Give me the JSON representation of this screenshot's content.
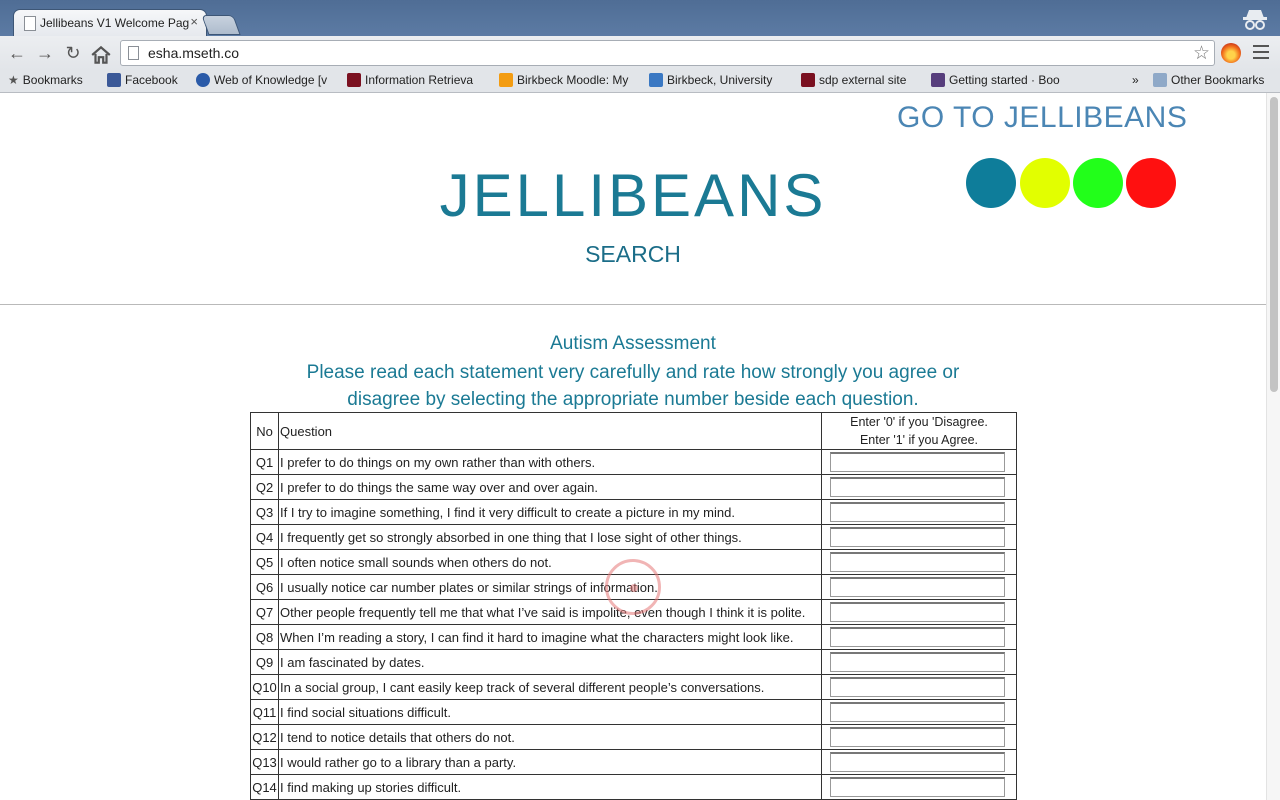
{
  "browser": {
    "tab_title": "Jellibeans V1 Welcome Pag",
    "tab_close": "×",
    "url": "esha.mseth.co",
    "bookmarks": [
      {
        "label": "Bookmarks",
        "icon": "star-icon"
      },
      {
        "label": "Facebook",
        "icon": "facebook-icon"
      },
      {
        "label": "Web of Knowledge [v",
        "icon": "web-of-knowledge-icon"
      },
      {
        "label": "Information Retrieva",
        "icon": "birkbeck-icon"
      },
      {
        "label": "Birkbeck Moodle: My",
        "icon": "moodle-icon"
      },
      {
        "label": "Birkbeck, University",
        "icon": "calendar-icon"
      },
      {
        "label": "sdp external site",
        "icon": "birkbeck-icon"
      },
      {
        "label": "Getting started · Boo",
        "icon": "bootstrap-icon"
      }
    ],
    "overflow": "»",
    "other_bookmarks": "Other Bookmarks"
  },
  "header": {
    "goto_label": "GO TO JELLIBEANS",
    "brand": "JELLIBEANS",
    "search_label": "SEARCH",
    "dots": [
      "#0e7d9a",
      "#e2ff00",
      "#22ff1a",
      "#ff1010"
    ]
  },
  "assessment": {
    "title": "Autism Assessment",
    "instructions": "Please read each statement very carefully and rate how strongly you agree or disagree by selecting the appropriate number beside each question.",
    "columns": {
      "no": "No",
      "question": "Question",
      "answer_line1": "Enter '0' if you 'Disagree.",
      "answer_line2": "Enter '1' if you Agree."
    },
    "rows": [
      {
        "no": "Q1",
        "text": "I prefer to do things on my own rather than with others.",
        "value": ""
      },
      {
        "no": "Q2",
        "text": "I prefer to do things the same way over and over again.",
        "value": ""
      },
      {
        "no": "Q3",
        "text": "If I try to imagine something, I find it very difficult to create a picture in my mind.",
        "value": ""
      },
      {
        "no": "Q4",
        "text": "I frequently get so strongly absorbed in one thing that I lose sight of other things.",
        "value": ""
      },
      {
        "no": "Q5",
        "text": "I often notice small sounds when others do not.",
        "value": ""
      },
      {
        "no": "Q6",
        "text": "I usually notice car number plates or similar strings of information.",
        "value": ""
      },
      {
        "no": "Q7",
        "text": "Other people frequently tell me that what I’ve said is impolite, even though I think it is polite.",
        "value": ""
      },
      {
        "no": "Q8",
        "text": "When I’m reading a story, I can find it hard to imagine what the characters might look like.",
        "value": ""
      },
      {
        "no": "Q9",
        "text": "I am fascinated by dates.",
        "value": ""
      },
      {
        "no": "Q10",
        "text": "In a social group, I cant easily keep track of several different people’s conversations.",
        "value": ""
      },
      {
        "no": "Q11",
        "text": "I find social situations difficult.",
        "value": ""
      },
      {
        "no": "Q12",
        "text": "I tend to notice details that others do not.",
        "value": ""
      },
      {
        "no": "Q13",
        "text": "I would rather go to a library than a party.",
        "value": ""
      },
      {
        "no": "Q14",
        "text": "I find making up stories difficult.",
        "value": ""
      }
    ]
  }
}
